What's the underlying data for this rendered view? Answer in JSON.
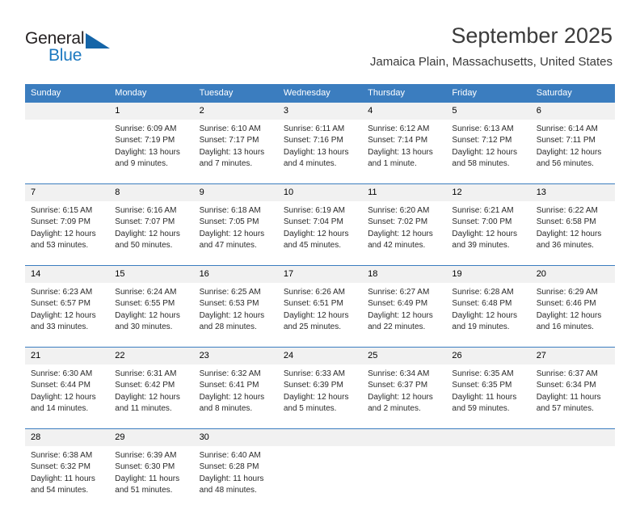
{
  "brand": {
    "name_part1": "General",
    "name_part2": "Blue",
    "triangle_icon": "blue-triangle-logo-icon",
    "accent_color": "#1565a8"
  },
  "header": {
    "title": "September 2025",
    "location": "Jamaica Plain, Massachusetts, United States"
  },
  "colors": {
    "header_blue": "#3b7dbf",
    "daynum_band": "#f1f1f1",
    "text": "#2a2a2a"
  },
  "calendar": {
    "weekday_headers": [
      "Sunday",
      "Monday",
      "Tuesday",
      "Wednesday",
      "Thursday",
      "Friday",
      "Saturday"
    ],
    "weeks": [
      [
        {
          "day": "",
          "sunrise": "",
          "sunset": "",
          "daylight1": "",
          "daylight2": ""
        },
        {
          "day": "1",
          "sunrise": "Sunrise: 6:09 AM",
          "sunset": "Sunset: 7:19 PM",
          "daylight1": "Daylight: 13 hours",
          "daylight2": "and 9 minutes."
        },
        {
          "day": "2",
          "sunrise": "Sunrise: 6:10 AM",
          "sunset": "Sunset: 7:17 PM",
          "daylight1": "Daylight: 13 hours",
          "daylight2": "and 7 minutes."
        },
        {
          "day": "3",
          "sunrise": "Sunrise: 6:11 AM",
          "sunset": "Sunset: 7:16 PM",
          "daylight1": "Daylight: 13 hours",
          "daylight2": "and 4 minutes."
        },
        {
          "day": "4",
          "sunrise": "Sunrise: 6:12 AM",
          "sunset": "Sunset: 7:14 PM",
          "daylight1": "Daylight: 13 hours",
          "daylight2": "and 1 minute."
        },
        {
          "day": "5",
          "sunrise": "Sunrise: 6:13 AM",
          "sunset": "Sunset: 7:12 PM",
          "daylight1": "Daylight: 12 hours",
          "daylight2": "and 58 minutes."
        },
        {
          "day": "6",
          "sunrise": "Sunrise: 6:14 AM",
          "sunset": "Sunset: 7:11 PM",
          "daylight1": "Daylight: 12 hours",
          "daylight2": "and 56 minutes."
        }
      ],
      [
        {
          "day": "7",
          "sunrise": "Sunrise: 6:15 AM",
          "sunset": "Sunset: 7:09 PM",
          "daylight1": "Daylight: 12 hours",
          "daylight2": "and 53 minutes."
        },
        {
          "day": "8",
          "sunrise": "Sunrise: 6:16 AM",
          "sunset": "Sunset: 7:07 PM",
          "daylight1": "Daylight: 12 hours",
          "daylight2": "and 50 minutes."
        },
        {
          "day": "9",
          "sunrise": "Sunrise: 6:18 AM",
          "sunset": "Sunset: 7:05 PM",
          "daylight1": "Daylight: 12 hours",
          "daylight2": "and 47 minutes."
        },
        {
          "day": "10",
          "sunrise": "Sunrise: 6:19 AM",
          "sunset": "Sunset: 7:04 PM",
          "daylight1": "Daylight: 12 hours",
          "daylight2": "and 45 minutes."
        },
        {
          "day": "11",
          "sunrise": "Sunrise: 6:20 AM",
          "sunset": "Sunset: 7:02 PM",
          "daylight1": "Daylight: 12 hours",
          "daylight2": "and 42 minutes."
        },
        {
          "day": "12",
          "sunrise": "Sunrise: 6:21 AM",
          "sunset": "Sunset: 7:00 PM",
          "daylight1": "Daylight: 12 hours",
          "daylight2": "and 39 minutes."
        },
        {
          "day": "13",
          "sunrise": "Sunrise: 6:22 AM",
          "sunset": "Sunset: 6:58 PM",
          "daylight1": "Daylight: 12 hours",
          "daylight2": "and 36 minutes."
        }
      ],
      [
        {
          "day": "14",
          "sunrise": "Sunrise: 6:23 AM",
          "sunset": "Sunset: 6:57 PM",
          "daylight1": "Daylight: 12 hours",
          "daylight2": "and 33 minutes."
        },
        {
          "day": "15",
          "sunrise": "Sunrise: 6:24 AM",
          "sunset": "Sunset: 6:55 PM",
          "daylight1": "Daylight: 12 hours",
          "daylight2": "and 30 minutes."
        },
        {
          "day": "16",
          "sunrise": "Sunrise: 6:25 AM",
          "sunset": "Sunset: 6:53 PM",
          "daylight1": "Daylight: 12 hours",
          "daylight2": "and 28 minutes."
        },
        {
          "day": "17",
          "sunrise": "Sunrise: 6:26 AM",
          "sunset": "Sunset: 6:51 PM",
          "daylight1": "Daylight: 12 hours",
          "daylight2": "and 25 minutes."
        },
        {
          "day": "18",
          "sunrise": "Sunrise: 6:27 AM",
          "sunset": "Sunset: 6:49 PM",
          "daylight1": "Daylight: 12 hours",
          "daylight2": "and 22 minutes."
        },
        {
          "day": "19",
          "sunrise": "Sunrise: 6:28 AM",
          "sunset": "Sunset: 6:48 PM",
          "daylight1": "Daylight: 12 hours",
          "daylight2": "and 19 minutes."
        },
        {
          "day": "20",
          "sunrise": "Sunrise: 6:29 AM",
          "sunset": "Sunset: 6:46 PM",
          "daylight1": "Daylight: 12 hours",
          "daylight2": "and 16 minutes."
        }
      ],
      [
        {
          "day": "21",
          "sunrise": "Sunrise: 6:30 AM",
          "sunset": "Sunset: 6:44 PM",
          "daylight1": "Daylight: 12 hours",
          "daylight2": "and 14 minutes."
        },
        {
          "day": "22",
          "sunrise": "Sunrise: 6:31 AM",
          "sunset": "Sunset: 6:42 PM",
          "daylight1": "Daylight: 12 hours",
          "daylight2": "and 11 minutes."
        },
        {
          "day": "23",
          "sunrise": "Sunrise: 6:32 AM",
          "sunset": "Sunset: 6:41 PM",
          "daylight1": "Daylight: 12 hours",
          "daylight2": "and 8 minutes."
        },
        {
          "day": "24",
          "sunrise": "Sunrise: 6:33 AM",
          "sunset": "Sunset: 6:39 PM",
          "daylight1": "Daylight: 12 hours",
          "daylight2": "and 5 minutes."
        },
        {
          "day": "25",
          "sunrise": "Sunrise: 6:34 AM",
          "sunset": "Sunset: 6:37 PM",
          "daylight1": "Daylight: 12 hours",
          "daylight2": "and 2 minutes."
        },
        {
          "day": "26",
          "sunrise": "Sunrise: 6:35 AM",
          "sunset": "Sunset: 6:35 PM",
          "daylight1": "Daylight: 11 hours",
          "daylight2": "and 59 minutes."
        },
        {
          "day": "27",
          "sunrise": "Sunrise: 6:37 AM",
          "sunset": "Sunset: 6:34 PM",
          "daylight1": "Daylight: 11 hours",
          "daylight2": "and 57 minutes."
        }
      ],
      [
        {
          "day": "28",
          "sunrise": "Sunrise: 6:38 AM",
          "sunset": "Sunset: 6:32 PM",
          "daylight1": "Daylight: 11 hours",
          "daylight2": "and 54 minutes."
        },
        {
          "day": "29",
          "sunrise": "Sunrise: 6:39 AM",
          "sunset": "Sunset: 6:30 PM",
          "daylight1": "Daylight: 11 hours",
          "daylight2": "and 51 minutes."
        },
        {
          "day": "30",
          "sunrise": "Sunrise: 6:40 AM",
          "sunset": "Sunset: 6:28 PM",
          "daylight1": "Daylight: 11 hours",
          "daylight2": "and 48 minutes."
        },
        {
          "day": "",
          "sunrise": "",
          "sunset": "",
          "daylight1": "",
          "daylight2": ""
        },
        {
          "day": "",
          "sunrise": "",
          "sunset": "",
          "daylight1": "",
          "daylight2": ""
        },
        {
          "day": "",
          "sunrise": "",
          "sunset": "",
          "daylight1": "",
          "daylight2": ""
        },
        {
          "day": "",
          "sunrise": "",
          "sunset": "",
          "daylight1": "",
          "daylight2": ""
        }
      ]
    ]
  }
}
